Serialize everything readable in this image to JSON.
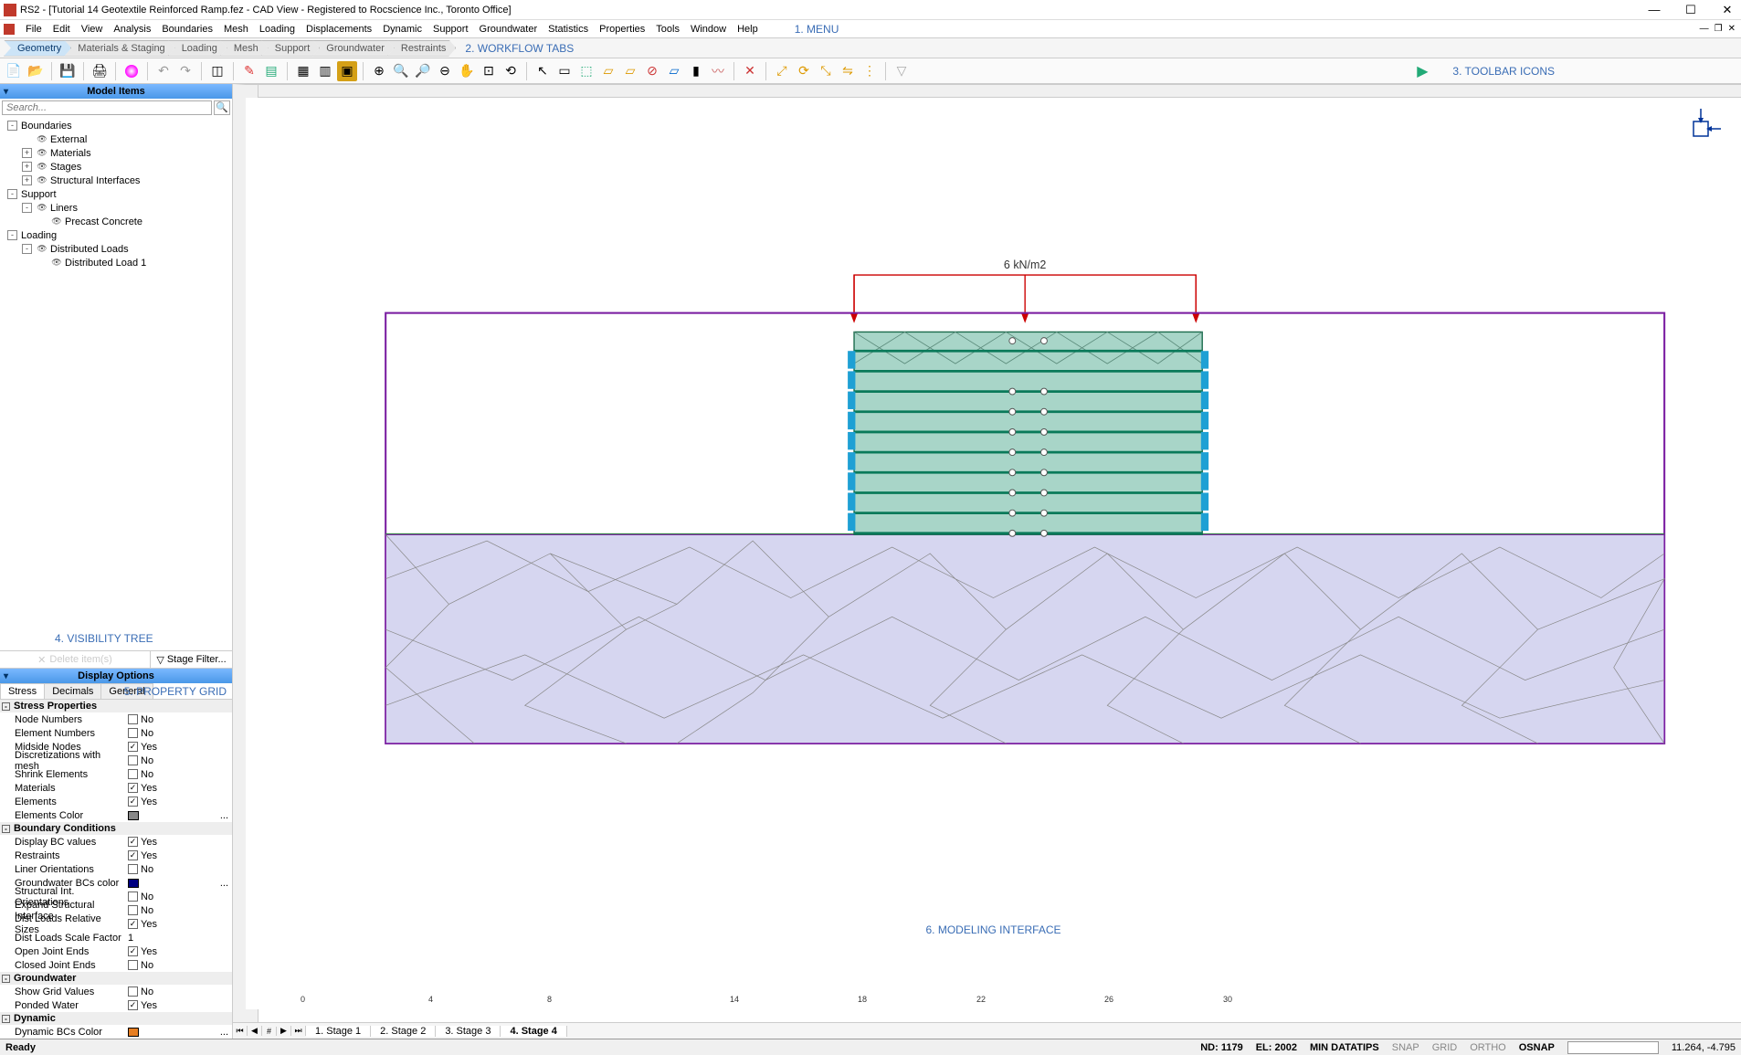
{
  "title": "RS2 - [Tutorial 14 Geotextile Reinforced Ramp.fez - CAD View - Registered to Rocscience Inc., Toronto Office]",
  "menu": [
    "File",
    "Edit",
    "View",
    "Analysis",
    "Boundaries",
    "Mesh",
    "Loading",
    "Displacements",
    "Dynamic",
    "Support",
    "Groundwater",
    "Statistics",
    "Properties",
    "Tools",
    "Window",
    "Help"
  ],
  "annotations": {
    "menu": "1. MENU",
    "workflow": "2. WORKFLOW TABS",
    "toolbar": "3. TOOLBAR ICONS",
    "tree": "4. VISIBILITY TREE",
    "props": "5. PROPERTY GRID",
    "model": "6. MODELING INTERFACE"
  },
  "workflow": {
    "tabs": [
      "Geometry",
      "Materials & Staging",
      "Loading",
      "Mesh",
      "Support",
      "Groundwater",
      "Restraints"
    ],
    "active": 0
  },
  "sidebar": {
    "model_items_title": "Model Items",
    "search_placeholder": "Search...",
    "tree": [
      {
        "label": "Boundaries",
        "depth": 0,
        "exp": "-"
      },
      {
        "label": "External",
        "depth": 1,
        "eye": true
      },
      {
        "label": "Materials",
        "depth": 1,
        "exp": "+",
        "eye": true
      },
      {
        "label": "Stages",
        "depth": 1,
        "exp": "+",
        "eye": true
      },
      {
        "label": "Structural Interfaces",
        "depth": 1,
        "exp": "+",
        "eye": true
      },
      {
        "label": "Support",
        "depth": 0,
        "exp": "-"
      },
      {
        "label": "Liners",
        "depth": 1,
        "exp": "-",
        "eye": true
      },
      {
        "label": "Precast Concrete",
        "depth": 2,
        "eye": true
      },
      {
        "label": "Loading",
        "depth": 0,
        "exp": "-"
      },
      {
        "label": "Distributed Loads",
        "depth": 1,
        "exp": "-",
        "eye": true
      },
      {
        "label": "Distributed Load 1",
        "depth": 2,
        "eye": true
      }
    ],
    "delete_label": "Delete item(s)",
    "filter_label": "Stage Filter...",
    "display_options_title": "Display Options",
    "dtabs": [
      "Stress",
      "Decimals",
      "General"
    ],
    "props": [
      {
        "group": "Stress Properties"
      },
      {
        "k": "Node Numbers",
        "type": "check",
        "checked": false,
        "v": "No"
      },
      {
        "k": "Element Numbers",
        "type": "check",
        "checked": false,
        "v": "No"
      },
      {
        "k": "Midside Nodes",
        "type": "check",
        "checked": true,
        "v": "Yes"
      },
      {
        "k": "Discretizations with mesh",
        "type": "check",
        "checked": false,
        "v": "No"
      },
      {
        "k": "Shrink Elements",
        "type": "check",
        "checked": false,
        "v": "No"
      },
      {
        "k": "Materials",
        "type": "check",
        "checked": true,
        "v": "Yes"
      },
      {
        "k": "Elements",
        "type": "check",
        "checked": true,
        "v": "Yes"
      },
      {
        "k": "Elements Color",
        "type": "color",
        "color": "#888",
        "dots": true
      },
      {
        "group": "Boundary Conditions"
      },
      {
        "k": "Display BC values",
        "type": "check",
        "checked": true,
        "v": "Yes"
      },
      {
        "k": "Restraints",
        "type": "check",
        "checked": true,
        "v": "Yes"
      },
      {
        "k": "Liner Orientations",
        "type": "check",
        "checked": false,
        "v": "No"
      },
      {
        "k": "Groundwater BCs color",
        "type": "color",
        "color": "#000080",
        "dots": true
      },
      {
        "k": "Structural Int. Orientations",
        "type": "check",
        "checked": false,
        "v": "No"
      },
      {
        "k": "Expand Structural Interface",
        "type": "check",
        "checked": false,
        "v": "No"
      },
      {
        "k": "Dist Loads Relative Sizes",
        "type": "check",
        "checked": true,
        "v": "Yes"
      },
      {
        "k": "Dist Loads Scale Factor",
        "type": "text",
        "v": "1"
      },
      {
        "k": "Open Joint Ends",
        "type": "check",
        "checked": true,
        "v": "Yes"
      },
      {
        "k": "Closed Joint Ends",
        "type": "check",
        "checked": false,
        "v": "No"
      },
      {
        "group": "Groundwater"
      },
      {
        "k": "Show Grid Values",
        "type": "check",
        "checked": false,
        "v": "No"
      },
      {
        "k": "Ponded Water",
        "type": "check",
        "checked": true,
        "v": "Yes"
      },
      {
        "group": "Dynamic"
      },
      {
        "k": "Dynamic BCs Color",
        "type": "color",
        "color": "#e67e22",
        "dots": true
      }
    ]
  },
  "stages": {
    "tabs": [
      "1. Stage 1",
      "2. Stage 2",
      "3. Stage 3",
      "4. Stage 4"
    ],
    "active": 3
  },
  "model": {
    "load_label": "6 kN/m2"
  },
  "ruler_x": [
    "0",
    "4",
    "8",
    "14",
    "18",
    "22",
    "26",
    "30"
  ],
  "status": {
    "ready": "Ready",
    "nd": "ND: 1179",
    "el": "EL: 2002",
    "min": "MIN DATATIPS",
    "snap": "SNAP",
    "grid": "GRID",
    "ortho": "ORTHO",
    "osnap": "OSNAP",
    "coords": "11.264,   -4.795"
  }
}
